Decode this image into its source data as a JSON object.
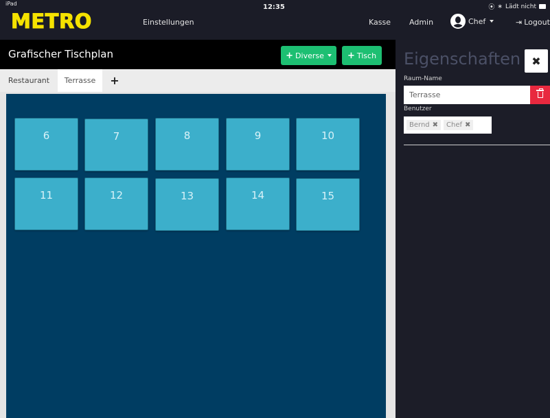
{
  "status": {
    "device": "iPad",
    "time": "12:35",
    "charging": "Lädt nicht"
  },
  "nav": {
    "logo": "METRO",
    "einstellungen": "Einstellungen",
    "kasse": "Kasse",
    "admin": "Admin",
    "user": "Chef",
    "logout": "Logout"
  },
  "main": {
    "title": "Grafischer Tischplan",
    "btn_diverse": "Diverse",
    "btn_tisch": "Tisch",
    "tabs": [
      {
        "label": "Restaurant",
        "active": false
      },
      {
        "label": "Terrasse",
        "active": true
      }
    ],
    "add_tab": "+",
    "tables": [
      "6",
      "7",
      "8",
      "9",
      "10",
      "11",
      "12",
      "13",
      "14",
      "15"
    ]
  },
  "properties": {
    "title": "Eigenschaften",
    "close": "✖",
    "raum_label": "Raum-Name",
    "raum_value": "Terrasse",
    "benutzer_label": "Benutzer",
    "users": [
      "Bernd",
      "Chef"
    ]
  },
  "colors": {
    "accent_green": "#1dbf72",
    "danger_red": "#e8293f",
    "canvas_bg": "#003d62",
    "table_tile": "#3cafcb",
    "logo_yellow": "#f5e200"
  }
}
